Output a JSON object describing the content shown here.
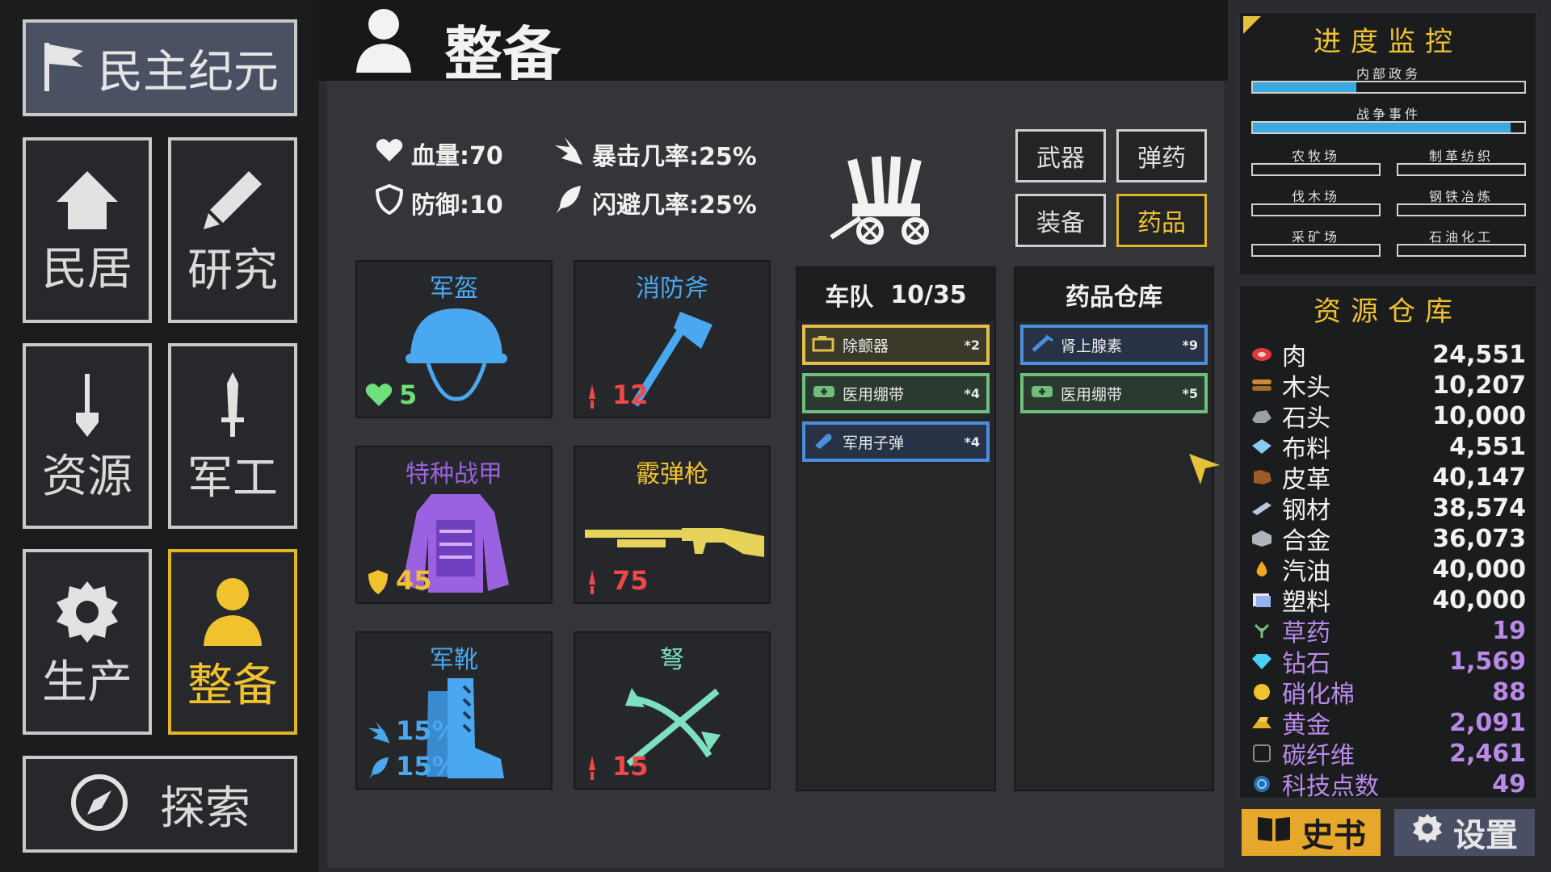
{
  "nav": {
    "era_label": "民主纪元",
    "housing": "民居",
    "research": "研究",
    "resources": "资源",
    "military": "军工",
    "production": "生产",
    "equip": "整备",
    "explore": "探索"
  },
  "header": {
    "title": "整备"
  },
  "stats": {
    "hp": "血量:70",
    "defense": "防御:10",
    "crit": "暴击几率:25%",
    "dodge": "闪避几率:25%"
  },
  "slots": {
    "helmet": {
      "name": "军盔",
      "value": "5"
    },
    "axe": {
      "name": "消防斧",
      "value": "12"
    },
    "armor": {
      "name": "特种战甲",
      "value": "45"
    },
    "shotgun": {
      "name": "霰弹枪",
      "value": "75"
    },
    "boots": {
      "name": "军靴",
      "value1": "15%",
      "value2": "15%"
    },
    "crossbow": {
      "name": "弩",
      "value": "15"
    }
  },
  "tabs": {
    "weapons": "武器",
    "ammo": "弹药",
    "equipment": "装备",
    "medicine": "药品"
  },
  "team": {
    "title": "车队",
    "count": "10/35",
    "items": [
      {
        "name": "除颤器",
        "count": "*2"
      },
      {
        "name": "医用绷带",
        "count": "*4"
      },
      {
        "name": "军用子弹",
        "count": "*4"
      }
    ]
  },
  "warehouse": {
    "title": "药品仓库",
    "items": [
      {
        "name": "肾上腺素",
        "count": "*9"
      },
      {
        "name": "医用绷带",
        "count": "*5"
      }
    ]
  },
  "monitor": {
    "title": "进度监控",
    "bars": [
      {
        "label": "内部政务",
        "progress": 0.38
      },
      {
        "label": "战争事件",
        "progress": 0.95
      },
      {
        "label": "农牧场",
        "progress": 0
      },
      {
        "label": "制革纺织",
        "progress": 0
      },
      {
        "label": "伐木场",
        "progress": 0
      },
      {
        "label": "钢铁冶炼",
        "progress": 0
      },
      {
        "label": "采矿场",
        "progress": 0
      },
      {
        "label": "石油化工",
        "progress": 0
      }
    ]
  },
  "storage": {
    "title": "资源仓库",
    "items": [
      {
        "name": "肉",
        "value": "24,551",
        "color": "#f2f2f2",
        "icon": "meat-icon"
      },
      {
        "name": "木头",
        "value": "10,207",
        "color": "#f2f2f2",
        "icon": "wood-icon"
      },
      {
        "name": "石头",
        "value": "10,000",
        "color": "#f2f2f2",
        "icon": "stone-icon"
      },
      {
        "name": "布料",
        "value": "4,551",
        "color": "#f2f2f2",
        "icon": "cloth-icon"
      },
      {
        "name": "皮革",
        "value": "40,147",
        "color": "#f2f2f2",
        "icon": "leather-icon"
      },
      {
        "name": "钢材",
        "value": "38,574",
        "color": "#f2f2f2",
        "icon": "steel-icon"
      },
      {
        "name": "合金",
        "value": "36,073",
        "color": "#f2f2f2",
        "icon": "alloy-icon"
      },
      {
        "name": "汽油",
        "value": "40,000",
        "color": "#f2f2f2",
        "icon": "gasoline-icon"
      },
      {
        "name": "塑料",
        "value": "40,000",
        "color": "#f2f2f2",
        "icon": "plastic-icon"
      },
      {
        "name": "草药",
        "value": "19",
        "color": "#b98ae8",
        "icon": "herb-icon"
      },
      {
        "name": "钻石",
        "value": "1,569",
        "color": "#b98ae8",
        "icon": "diamond-icon"
      },
      {
        "name": "硝化棉",
        "value": "88",
        "color": "#b98ae8",
        "icon": "nitrocellulose-icon"
      },
      {
        "name": "黄金",
        "value": "2,091",
        "color": "#b98ae8",
        "icon": "gold-icon"
      },
      {
        "name": "碳纤维",
        "value": "2,461",
        "color": "#b98ae8",
        "icon": "carbon-fiber-icon"
      },
      {
        "name": "科技点数",
        "value": "49",
        "color": "#b98ae8",
        "icon": "tech-points-icon"
      }
    ]
  },
  "footer": {
    "history": "史书",
    "settings": "设置"
  },
  "colors": {
    "accent": "#f0c22e",
    "blue": "#4aa8f0",
    "purple": "#9a62e0",
    "red": "#f04848",
    "green": "#6ee07a"
  }
}
